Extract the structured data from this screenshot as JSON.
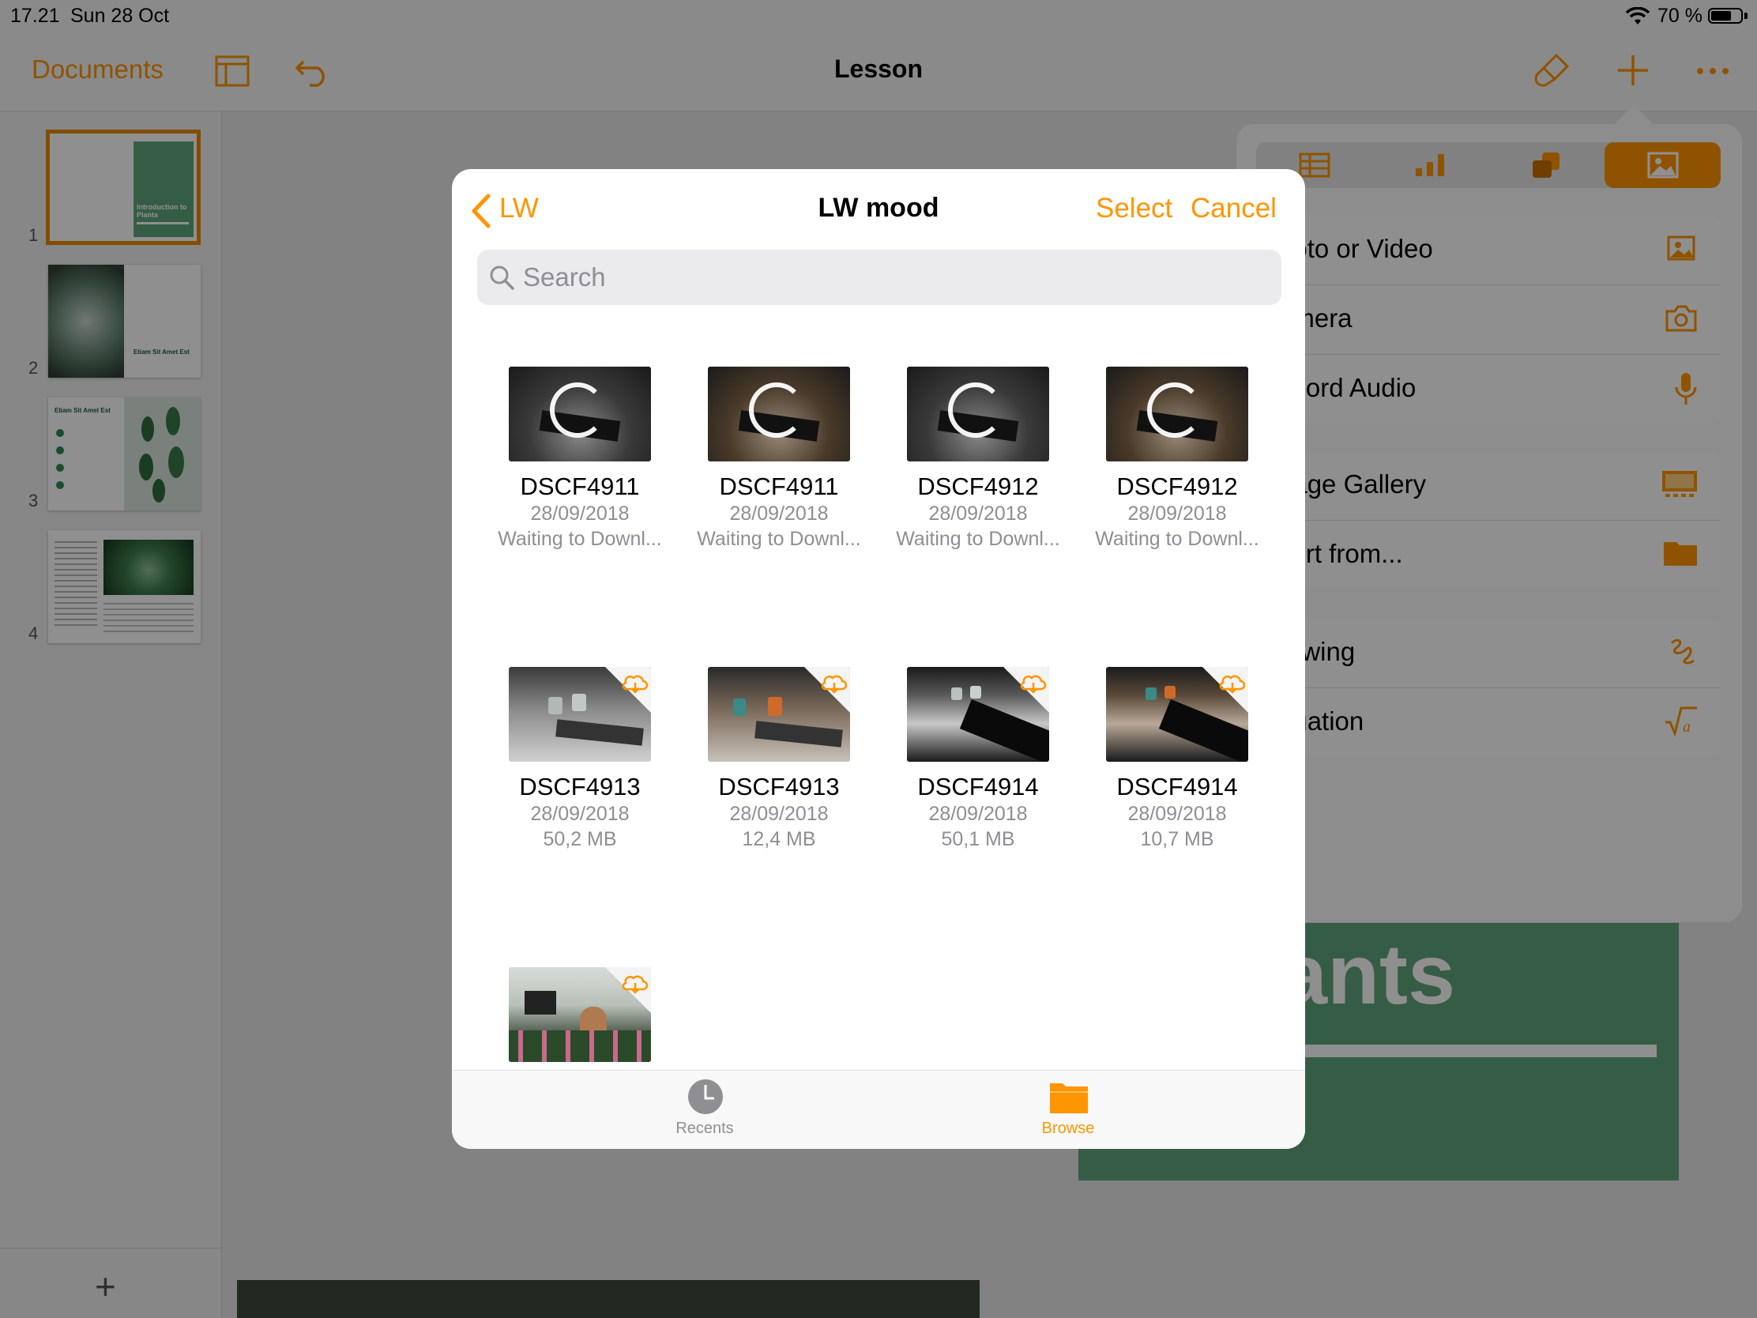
{
  "status_bar": {
    "time": "17.21",
    "date": "Sun 28 Oct",
    "battery_percent": "70 %",
    "battery_level": 0.7
  },
  "toolbar": {
    "documents_label": "Documents",
    "title": "Lesson"
  },
  "navigator": {
    "slides": [
      {
        "number": "1",
        "heading": "Introduction to Plants"
      },
      {
        "number": "2",
        "heading": "Etiam Sit Amet Est"
      },
      {
        "number": "3",
        "heading": "Etiam Sit Amet Est"
      },
      {
        "number": "4",
        "heading": ""
      }
    ]
  },
  "canvas": {
    "slide_text": "ants"
  },
  "insert_popover": {
    "tabs": [
      "table-icon",
      "chart-icon",
      "shapes-icon",
      "media-icon"
    ],
    "selected_tab": "media-icon",
    "groups": [
      [
        {
          "label": "hoto or Video",
          "icon": "photo-icon"
        },
        {
          "label": "amera",
          "icon": "camera-icon"
        },
        {
          "label": "ecord Audio",
          "icon": "microphone-icon"
        }
      ],
      [
        {
          "label": "nage Gallery",
          "icon": "gallery-icon"
        },
        {
          "label": "sert from...",
          "icon": "folder-icon"
        }
      ],
      [
        {
          "label": "rawing",
          "icon": "drawing-icon"
        },
        {
          "label": "quation",
          "icon": "equation-icon"
        }
      ]
    ]
  },
  "file_browser": {
    "back_label": "LW",
    "title": "LW mood",
    "select_label": "Select",
    "cancel_label": "Cancel",
    "search_placeholder": "Search",
    "files": [
      {
        "name": "DSCF4911",
        "date": "28/09/2018",
        "meta": "Waiting to Downl...",
        "state": "downloading"
      },
      {
        "name": "DSCF4911",
        "date": "28/09/2018",
        "meta": "Waiting to Downl...",
        "state": "downloading"
      },
      {
        "name": "DSCF4912",
        "date": "28/09/2018",
        "meta": "Waiting to Downl...",
        "state": "downloading"
      },
      {
        "name": "DSCF4912",
        "date": "28/09/2018",
        "meta": "Waiting to Downl...",
        "state": "downloading"
      },
      {
        "name": "DSCF4913",
        "date": "28/09/2018",
        "meta": "50,2 MB",
        "state": "cloud"
      },
      {
        "name": "DSCF4913",
        "date": "28/09/2018",
        "meta": "12,4 MB",
        "state": "cloud"
      },
      {
        "name": "DSCF4914",
        "date": "28/09/2018",
        "meta": "50,1 MB",
        "state": "cloud"
      },
      {
        "name": "DSCF4914",
        "date": "28/09/2018",
        "meta": "10,7 MB",
        "state": "cloud"
      },
      {
        "name": "",
        "date": "",
        "meta": "",
        "state": "cloud"
      }
    ],
    "tabs": {
      "recents_label": "Recents",
      "browse_label": "Browse",
      "selected": "browse"
    }
  },
  "colors": {
    "accent": "#ff9500",
    "slide_green": "#5fa77c",
    "selected_slide_border": "#e88a00"
  }
}
